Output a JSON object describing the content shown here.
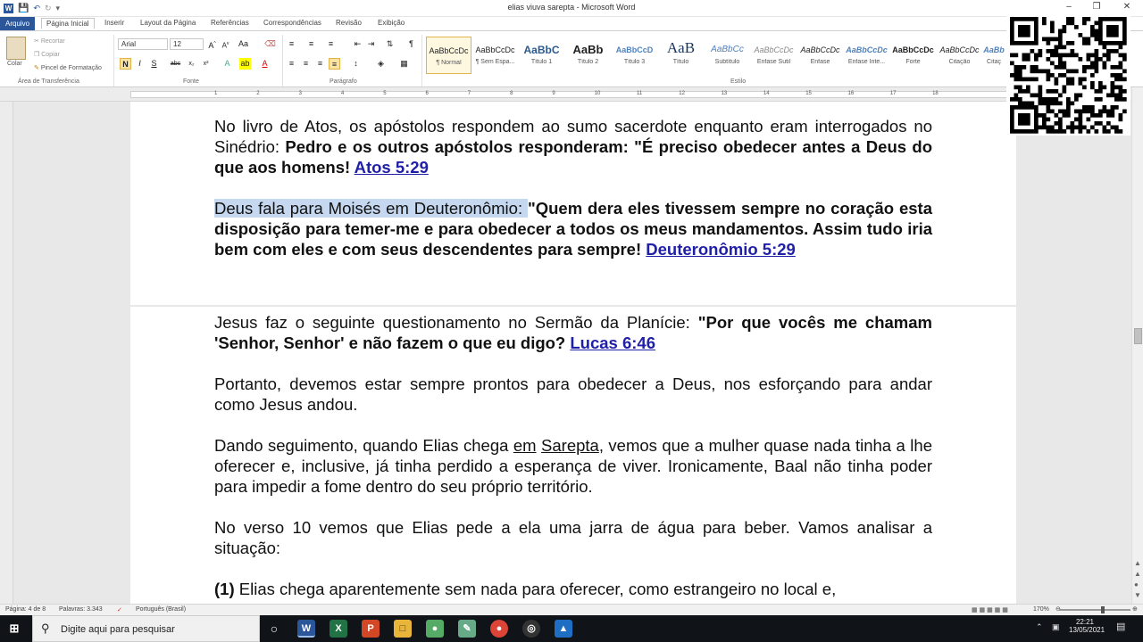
{
  "window": {
    "title": "elias viuva sarepta  -  Microsoft Word"
  },
  "tabs": [
    "Arquivo",
    "Página Inicial",
    "Inserir",
    "Layout da Página",
    "Referências",
    "Correspondências",
    "Revisão",
    "Exibição"
  ],
  "ribbon": {
    "clipboard": {
      "paste": "Colar",
      "cut": "Recortar",
      "copy": "Copiar",
      "painter": "Pincel de Formatação",
      "label": "Área de Transferência"
    },
    "font": {
      "name": "Arial",
      "size": "12",
      "label": "Fonte"
    },
    "paragraph": {
      "label": "Parágrafo"
    },
    "styles": {
      "label": "Estilo",
      "items": [
        {
          "preview": "AaBbCcDc",
          "name": "¶ Normal"
        },
        {
          "preview": "AaBbCcDc",
          "name": "¶ Sem Espa..."
        },
        {
          "preview": "AaBbC",
          "name": "Título 1"
        },
        {
          "preview": "AaBb",
          "name": "Título 2"
        },
        {
          "preview": "AaBbCcD",
          "name": "Título 3"
        },
        {
          "preview": "AaB",
          "name": "Título"
        },
        {
          "preview": "AaBbCc",
          "name": "Subtítulo"
        },
        {
          "preview": "AaBbCcDc",
          "name": "Ênfase Sutil"
        },
        {
          "preview": "AaBbCcDc",
          "name": "Ênfase"
        },
        {
          "preview": "AaBbCcDc",
          "name": "Ênfase Inte..."
        },
        {
          "preview": "AaBbCcDc",
          "name": "Forte"
        },
        {
          "preview": "AaBbCcDc",
          "name": "Citação"
        },
        {
          "preview": "AaBb",
          "name": "Citaç"
        }
      ]
    }
  },
  "ruler": {
    "numbers": [
      "1",
      "2",
      "3",
      "4",
      "5",
      "6",
      "7",
      "8",
      "9",
      "10",
      "11",
      "12",
      "13",
      "14",
      "15",
      "16",
      "17",
      "18"
    ]
  },
  "document": {
    "p1": {
      "normal": "No livro de Atos, os apóstolos respondem ao sumo sacerdote enquanto eram interrogados no Sinédrio: ",
      "bold": "Pedro e os outros apóstolos responderam: \"É preciso obedecer antes a Deus do que aos homens! ",
      "ref": "Atos 5:29"
    },
    "p2": {
      "highlight": "Deus fala para Moisés em Deuteronômio: ",
      "bold": "\"Quem dera eles tivessem sempre no coração esta disposição para temer-me e para obedecer a todos os meus mandamentos. Assim tudo iria bem com eles e com seus descendentes para sempre! ",
      "ref": "Deuteronômio 5:29"
    },
    "p3": {
      "normal": "Jesus faz o seguinte questionamento no Sermão da Planície: ",
      "bold": "\"Por que vocês me chamam 'Senhor, Senhor' e não fazem o que eu digo? ",
      "ref": "Lucas 6:46"
    },
    "p4": "Portanto, devemos estar sempre prontos para obedecer a Deus, nos esforçando para andar como Jesus andou.",
    "p5": {
      "a": "Dando seguimento, quando Elias chega ",
      "u1": "em",
      "b": " ",
      "u2": "Sarepta",
      "c": ", vemos que a mulher quase nada tinha a lhe oferecer e, inclusive, já tinha perdido a esperança de viver. Ironicamente, Baal não tinha poder para impedir a fome dentro do seu próprio território."
    },
    "p6": "No verso 10 vemos que Elias pede a ela uma jarra de água para beber. Vamos analisar a situação:",
    "p7": {
      "num": "(1)",
      "text": " Elias chega aparentemente sem nada para oferecer, como estrangeiro no local e,"
    }
  },
  "status": {
    "page": "Página: 4 de 8",
    "words": "Palavras: 3.343",
    "language": "Português (Brasil)",
    "zoom": "170%"
  },
  "taskbar": {
    "search_placeholder": "Digite aqui para pesquisar",
    "time": "22:21",
    "date": "13/05/2021"
  }
}
